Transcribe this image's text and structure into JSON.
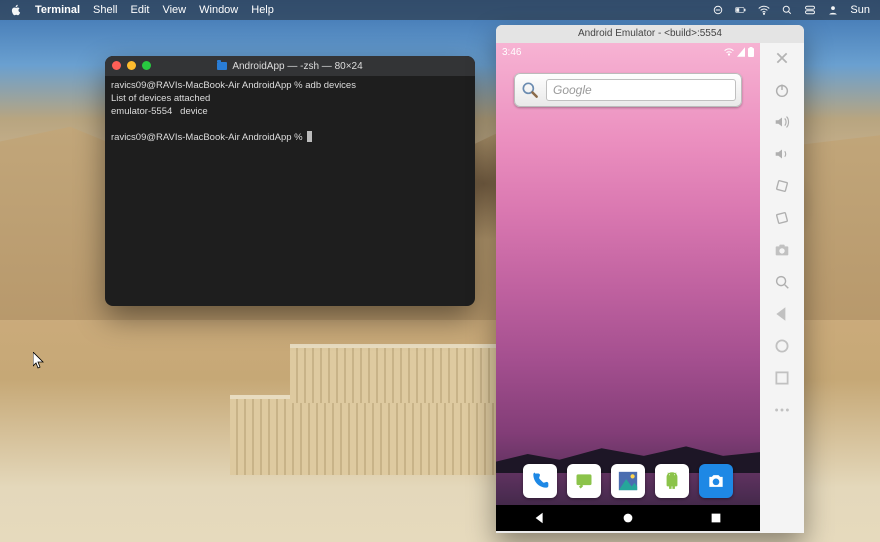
{
  "menubar": {
    "app_name": "Terminal",
    "items": [
      "Shell",
      "Edit",
      "View",
      "Window",
      "Help"
    ],
    "clock_suffix": "Sun"
  },
  "terminal": {
    "title": "AndroidApp — -zsh — 80×24",
    "lines": [
      "ravics09@RAVIs-MacBook-Air AndroidApp % adb devices",
      "List of devices attached",
      "emulator-5554   device",
      "",
      "ravics09@RAVIs-MacBook-Air AndroidApp % "
    ]
  },
  "emulator": {
    "title": "Android Emulator - <build>:5554",
    "status_time": "3:46",
    "search_placeholder": "Google",
    "apps": [
      {
        "name": "phone",
        "bg": "white",
        "color": "#1e88e5"
      },
      {
        "name": "messages",
        "bg": "white",
        "color": "#8bc34a"
      },
      {
        "name": "gallery",
        "bg": "white",
        "color": "#e91e63"
      },
      {
        "name": "android",
        "bg": "white",
        "color": "#8bc34a"
      },
      {
        "name": "camera",
        "bg": "blue",
        "color": "#ffffff"
      }
    ],
    "toolbar": [
      "close",
      "power",
      "volume-up",
      "volume-down",
      "rotate-left",
      "rotate-right",
      "screenshot",
      "zoom",
      "back",
      "home",
      "overview",
      "more"
    ]
  }
}
